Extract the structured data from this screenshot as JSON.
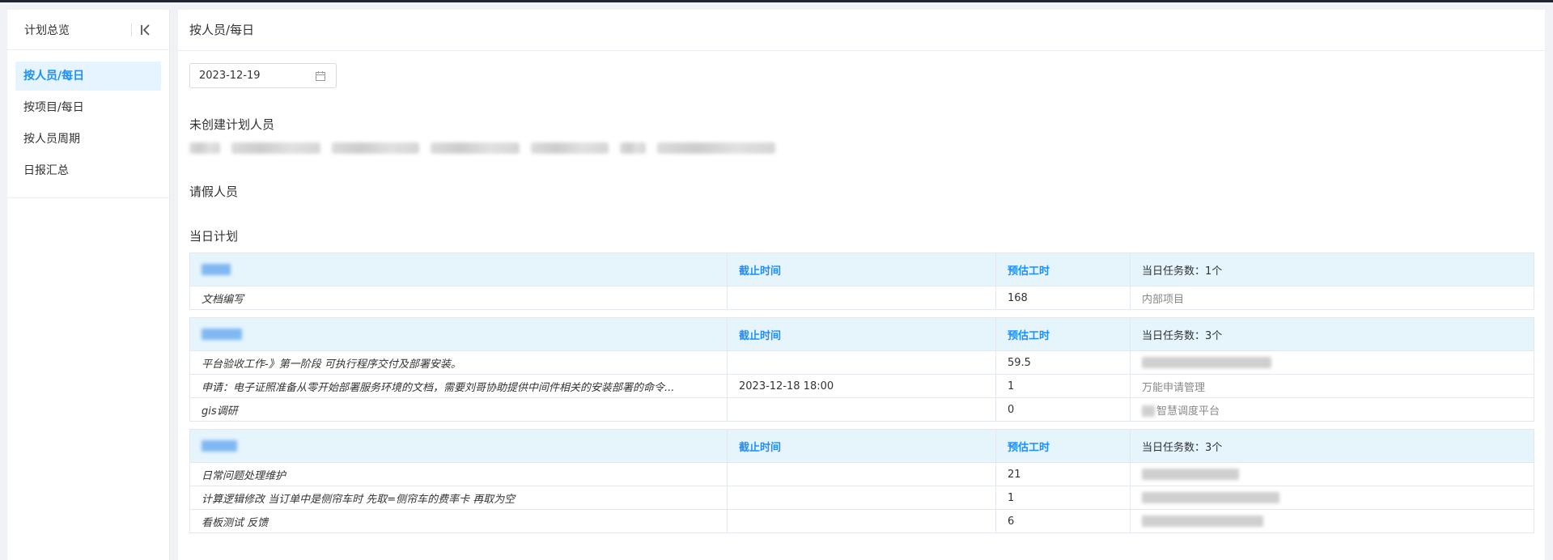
{
  "sidebar": {
    "title": "计划总览",
    "items": [
      {
        "label": "按人员/每日",
        "active": true
      },
      {
        "label": "按项目/每日",
        "active": false
      },
      {
        "label": "按人员周期",
        "active": false
      },
      {
        "label": "日报汇总",
        "active": false
      }
    ]
  },
  "main": {
    "header": "按人员/每日",
    "date_value": "2023-12-19",
    "sections": {
      "unplanned": "未创建计划人员",
      "leave": "请假人员",
      "daily_plan": "当日计划"
    },
    "tables": [
      {
        "deadline_header": "截止时间",
        "hours_header": "预估工时",
        "count": "当日任务数：1个",
        "rows": [
          {
            "task": "文档编写",
            "deadline": "",
            "hours": "168",
            "project": "内部项目"
          }
        ]
      },
      {
        "deadline_header": "截止时间",
        "hours_header": "预估工时",
        "count": "当日任务数：3个",
        "rows": [
          {
            "task": "平台验收工作-》第一阶段 可执行程序交付及部署安装。",
            "deadline": "",
            "hours": "59.5",
            "project": ""
          },
          {
            "task": "申请：电子证照准备从零开始部署服务环境的文档，需要刘哥协助提供中间件相关的安装部署的命令...",
            "deadline": "2023-12-18 18:00",
            "hours": "1",
            "project": "万能申请管理"
          },
          {
            "task": "gis调研",
            "deadline": "",
            "hours": "0",
            "project": "智慧调度平台"
          }
        ]
      },
      {
        "deadline_header": "截止时间",
        "hours_header": "预估工时",
        "count": "当日任务数：3个",
        "rows": [
          {
            "task": "日常问题处理维护",
            "deadline": "",
            "hours": "21",
            "project": ""
          },
          {
            "task": "计算逻辑修改 当订单中是侧帘车时 先取=侧帘车的费率卡 再取为空",
            "deadline": "",
            "hours": "1",
            "project": ""
          },
          {
            "task": "看板测试 反馈",
            "deadline": "",
            "hours": "6",
            "project": ""
          }
        ]
      }
    ]
  },
  "icons": {
    "collapse": "collapse-left-icon",
    "calendar": "calendar-icon"
  },
  "colors": {
    "accent": "#1890ff",
    "table_header_bg": "#e6f4fc",
    "active_menu_bg": "#e6f4ff"
  }
}
